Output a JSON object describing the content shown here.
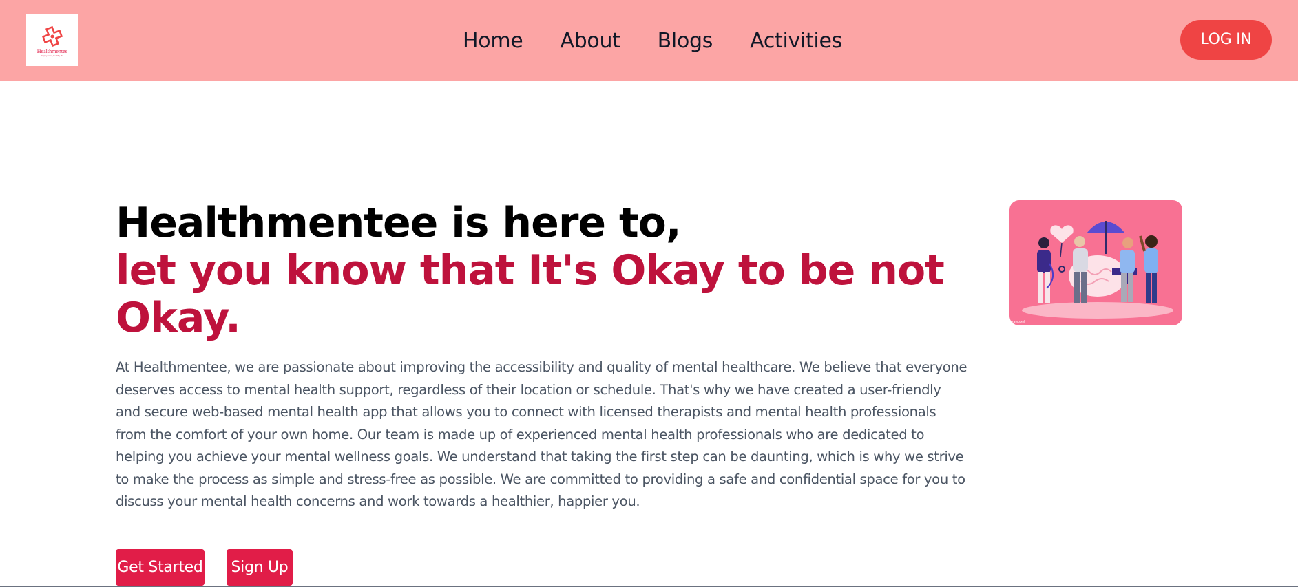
{
  "brand": {
    "logo_name": "Healthmentee",
    "logo_tagline": "happy mind, healthy life",
    "icon": "medical-cross-icon",
    "accent_color": "#e11d48"
  },
  "nav": {
    "items": [
      {
        "label": "Home"
      },
      {
        "label": "About"
      },
      {
        "label": "Blogs"
      },
      {
        "label": "Activities"
      }
    ],
    "login_label": "LOG IN",
    "background_color": "#fca5a5"
  },
  "hero": {
    "title_line1": "Healthmentee is here to,",
    "title_line2": "let you know that It's Okay to be not Okay.",
    "description": "At Healthmentee, we are passionate about improving the accessibility and quality of mental healthcare. We believe that everyone deserves access to mental health support, regardless of their location or schedule. That's why we have created a user-friendly and secure web-based mental health app that allows you to connect with licensed therapists and mental health professionals from the comfort of your own home. Our team is made up of experienced mental health professionals who are dedicated to helping you achieve your mental wellness goals. We understand that taking the first step can be daunting, which is why we strive to make the process as simple and stress-free as possible. We are committed to providing a safe and confidential space for you to discuss your mental health concerns and work towards a healthier, happier you.",
    "get_started_label": "Get Started",
    "sign_up_label": "Sign Up",
    "illustration": "mental-health-illustration"
  }
}
